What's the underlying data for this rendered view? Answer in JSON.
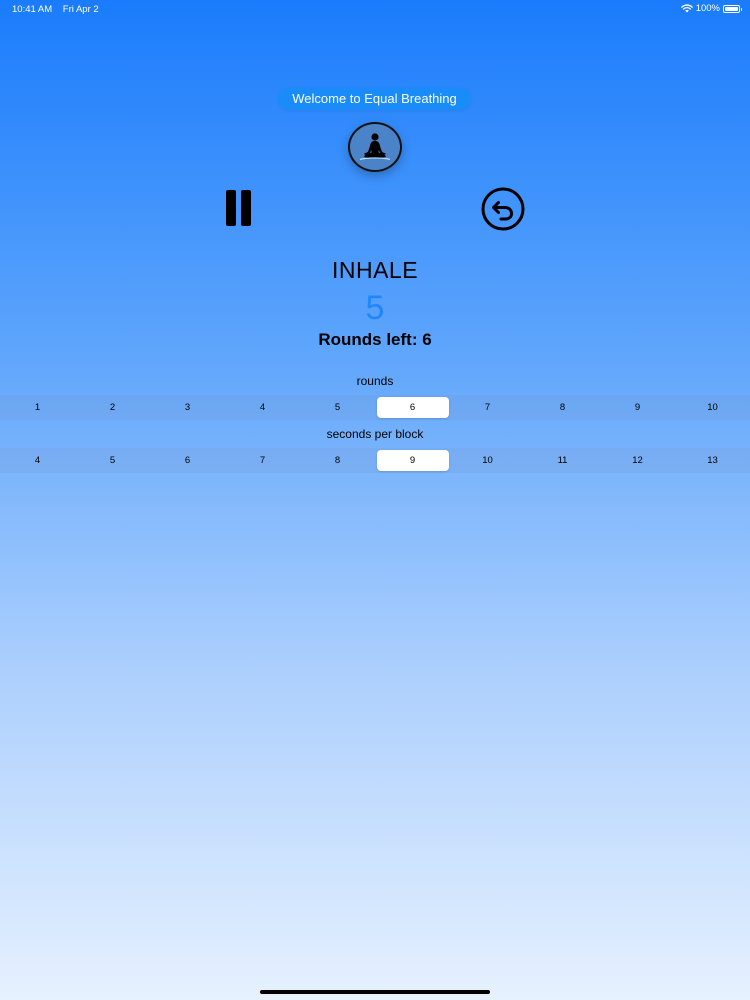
{
  "status_bar": {
    "time": "10:41 AM",
    "date": "Fri Apr 2",
    "battery": "100%",
    "icons": [
      "wifi-icon",
      "battery-icon"
    ]
  },
  "header": {
    "welcome_text": "Welcome to Equal Breathing",
    "logo_icon": "meditation-icon"
  },
  "controls": {
    "pause_icon": "pause-icon",
    "reset_icon": "reset-arrow-icon"
  },
  "session": {
    "phase": "INHALE",
    "countdown": "5",
    "rounds_left_label": "Rounds left: 6"
  },
  "rounds_picker": {
    "title": "rounds",
    "options": [
      "1",
      "2",
      "3",
      "4",
      "5",
      "6",
      "7",
      "8",
      "9",
      "10"
    ],
    "selected": "6"
  },
  "seconds_picker": {
    "title": "seconds per block",
    "options": [
      "4",
      "5",
      "6",
      "7",
      "8",
      "9",
      "10",
      "11",
      "12",
      "13"
    ],
    "selected": "9"
  },
  "colors": {
    "accent": "#1e87fb",
    "pill": "#1a8cfa",
    "gradient_top": "#1a7cfc",
    "gradient_bottom": "#e6f1fe"
  }
}
